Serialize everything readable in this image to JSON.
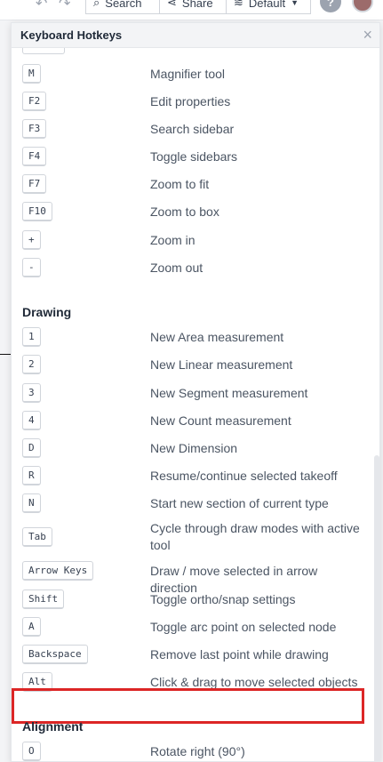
{
  "toolbar": {
    "search_label": "Search",
    "share_label": "Share",
    "layers_label": "Default",
    "help_label": "?"
  },
  "modal": {
    "title": "Keyboard Hotkeys",
    "close": "×"
  },
  "navigation": [
    {
      "key": "M",
      "desc": "Magnifier tool"
    },
    {
      "key": "F2",
      "desc": "Edit properties"
    },
    {
      "key": "F3",
      "desc": "Search sidebar"
    },
    {
      "key": "F4",
      "desc": "Toggle sidebars"
    },
    {
      "key": "F7",
      "desc": "Zoom to fit"
    },
    {
      "key": "F10",
      "desc": "Zoom to box"
    },
    {
      "key": "+",
      "desc": "Zoom in"
    },
    {
      "key": "-",
      "desc": "Zoom out"
    }
  ],
  "drawing": {
    "title": "Drawing",
    "items": [
      {
        "key": "1",
        "desc": "New Area measurement"
      },
      {
        "key": "2",
        "desc": "New Linear measurement"
      },
      {
        "key": "3",
        "desc": "New Segment measurement"
      },
      {
        "key": "4",
        "desc": "New Count measurement"
      },
      {
        "key": "D",
        "desc": "New Dimension"
      },
      {
        "key": "R",
        "desc": "Resume/continue selected takeoff"
      },
      {
        "key": "N",
        "desc": "Start new section of current type"
      },
      {
        "key": "Tab",
        "desc": "Cycle through draw modes with active tool"
      },
      {
        "key": "Arrow Keys",
        "desc": "Draw / move selected in arrow direction"
      },
      {
        "key": "Shift",
        "desc": "Toggle ortho/snap settings"
      },
      {
        "key": "A",
        "desc": "Toggle arc point on selected node"
      },
      {
        "key": "Backspace",
        "desc": "Remove last point while drawing"
      },
      {
        "key": "Alt",
        "desc": "Click & drag to move selected objects"
      }
    ]
  },
  "alignment": {
    "title": "Alignment",
    "items": [
      {
        "key": "O",
        "desc": "Rotate right (90°)"
      }
    ]
  }
}
